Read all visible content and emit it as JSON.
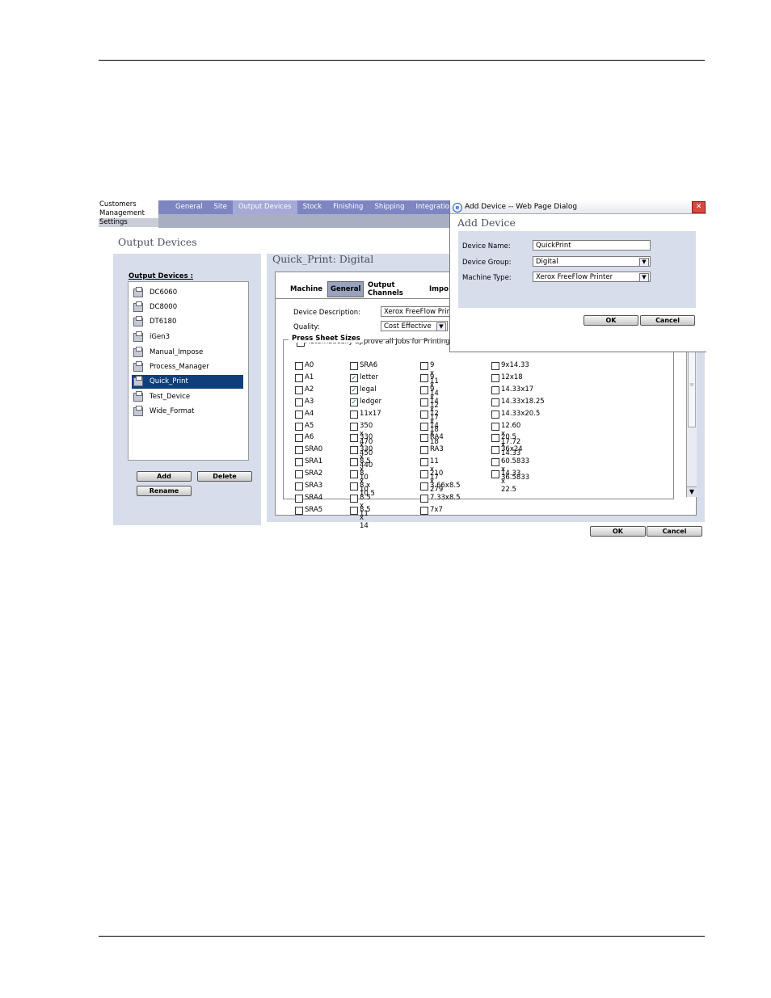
{
  "nav": {
    "categories": [
      "Customers",
      "Management",
      "Settings"
    ],
    "tabs": [
      "General",
      "Site",
      "Output Devices",
      "Stock",
      "Finishing",
      "Shipping",
      "Integrations"
    ]
  },
  "page_title": "Output Devices",
  "left_panel": {
    "list_label": "Output Devices :",
    "devices": [
      "DC6060",
      "DC8000",
      "DT6180",
      "iGen3",
      "Manual_Impose",
      "Process_Manager",
      "Quick_Print",
      "Test_Device",
      "Wide_Format"
    ],
    "selected_device": "Quick_Print",
    "add_label": "Add",
    "delete_label": "Delete",
    "rename_label": "Rename"
  },
  "right_panel": {
    "title": "Quick_Print: Digital",
    "tabs": {
      "machine": "Machine",
      "general": "General",
      "output_1": "Output",
      "output_2": "Channels",
      "impose": "Impo"
    },
    "device_description_label": "Device Description:",
    "device_description_value": "Xerox FreeFlow Prin",
    "quality_label": "Quality:",
    "quality_value": "Cost Effective",
    "auto_approve_label": "Automatically approve all Jobs for Printing",
    "press_sheet_sizes_label": "Press Sheet Sizes",
    "sizes": {
      "col1": [
        "A0",
        "A1",
        "A2",
        "A3",
        "A4",
        "A5",
        "A6",
        "SRA0",
        "SRA1",
        "SRA2",
        "SRA3",
        "SRA4",
        "SRA5"
      ],
      "col2": [
        "SRA6",
        "letter",
        "legal",
        "ledger",
        "11x17",
        "350 x 470",
        "330 x 450",
        "330 x 440",
        "8.5 x 10",
        "8 x 10",
        "8 x 10.5",
        "8.5 x 11",
        "8.5 x 14"
      ],
      "col3": [
        "9 x 11",
        "9 x 14",
        "9 x 12",
        "14 x 17",
        "12 x 18",
        "14 x 18",
        "RA4",
        "RA3",
        "11 x 17",
        "210 x 279",
        "3.66x8.5",
        "7.33x8.5",
        "7x7"
      ],
      "col4": [
        "9x14.33",
        "12x18",
        "14.33x17",
        "14.33x18.25",
        "14.33x20.5",
        "12.60 x 17.72",
        "20.5 x 14.33",
        "36x24",
        "60.5833 x 36.5833",
        "14.33 x 22.5"
      ]
    },
    "checked_sizes": [
      "letter",
      "legal",
      "ledger"
    ],
    "ok_label": "OK",
    "cancel_label": "Cancel"
  },
  "dialog": {
    "window_title": "Add Device -- Web Page Dialog",
    "heading": "Add Device",
    "device_name_label": "Device Name:",
    "device_name_value": "QuickPrint",
    "device_group_label": "Device Group:",
    "device_group_value": "Digital",
    "machine_type_label": "Machine Type:",
    "machine_type_value": "Xerox FreeFlow Printer",
    "ok_label": "OK",
    "cancel_label": "Cancel"
  },
  "icons": {
    "device": "printer-icon",
    "close": "close-icon",
    "dropdown": "chevron-down-icon",
    "check": "checkmark-icon",
    "ie": "ie-icon"
  },
  "colors": {
    "nav": "#7e85c0",
    "panel": "#d7ddea",
    "selection": "#0f3f7a"
  }
}
